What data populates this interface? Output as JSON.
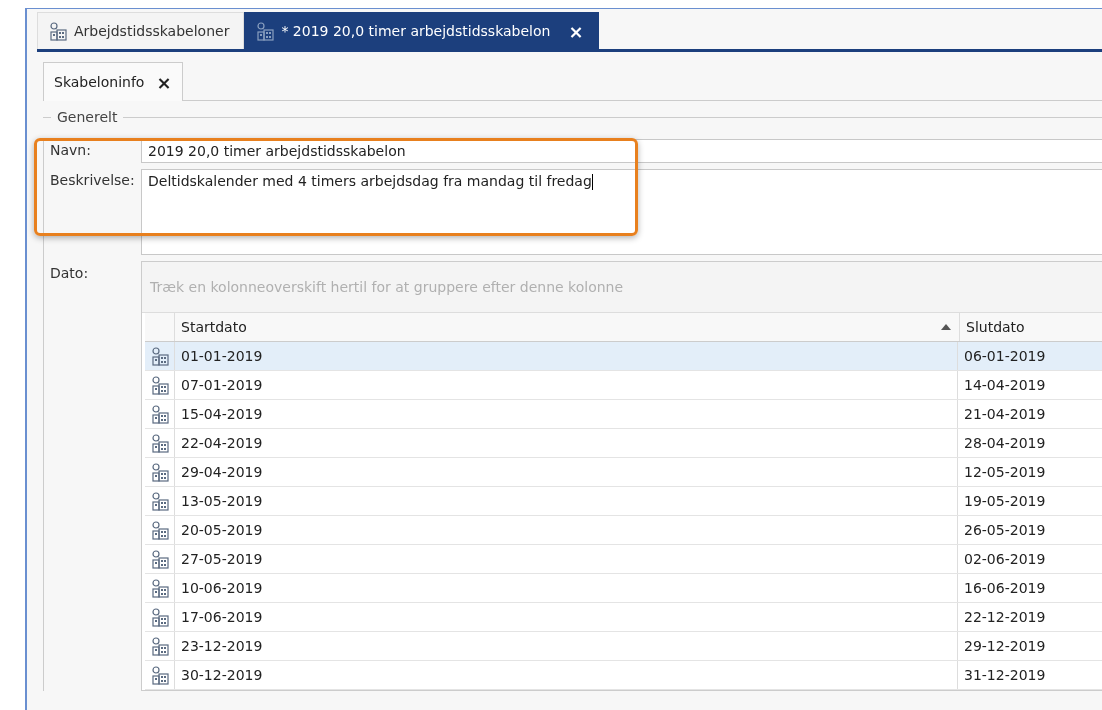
{
  "document_tabs": [
    {
      "label": "Arbejdstidsskabeloner",
      "selected": false,
      "closable": false
    },
    {
      "label": "* 2019 20,0 timer arbejdstidsskabelon",
      "selected": true,
      "closable": true
    }
  ],
  "close_glyph": "×",
  "sub_tabs": [
    {
      "label": "Skabeloninfo",
      "selected": true,
      "closable": true
    }
  ],
  "group": {
    "title": "Generelt"
  },
  "fields": [
    {
      "label": "Navn:",
      "value": "2019 20,0 timer arbejdstidsskabelon",
      "kind": "line"
    },
    {
      "label": "Beskrivelse:",
      "value": "Deltidskalender med 4 timers arbejdsdag fra mandag til fredag",
      "kind": "area"
    }
  ],
  "grid": {
    "label": "Dato:",
    "group_hint": "Træk en kolonneoverskift hertil for at gruppere efter denne kolonne",
    "columns": [
      {
        "name": "Startdato",
        "sorted": true
      },
      {
        "name": "Slutdato",
        "sorted": false
      }
    ],
    "rows": [
      {
        "cells": [
          "01-01-2019",
          "06-01-2019"
        ],
        "selected": true
      },
      {
        "cells": [
          "07-01-2019",
          "14-04-2019"
        ],
        "selected": false
      },
      {
        "cells": [
          "15-04-2019",
          "21-04-2019"
        ],
        "selected": false
      },
      {
        "cells": [
          "22-04-2019",
          "28-04-2019"
        ],
        "selected": false
      },
      {
        "cells": [
          "29-04-2019",
          "12-05-2019"
        ],
        "selected": false
      },
      {
        "cells": [
          "13-05-2019",
          "19-05-2019"
        ],
        "selected": false
      },
      {
        "cells": [
          "20-05-2019",
          "26-05-2019"
        ],
        "selected": false
      },
      {
        "cells": [
          "27-05-2019",
          "02-06-2019"
        ],
        "selected": false
      },
      {
        "cells": [
          "10-06-2019",
          "16-06-2019"
        ],
        "selected": false
      },
      {
        "cells": [
          "17-06-2019",
          "22-12-2019"
        ],
        "selected": false
      },
      {
        "cells": [
          "23-12-2019",
          "29-12-2019"
        ],
        "selected": false
      },
      {
        "cells": [
          "30-12-2019",
          "31-12-2019"
        ],
        "selected": false
      }
    ]
  }
}
